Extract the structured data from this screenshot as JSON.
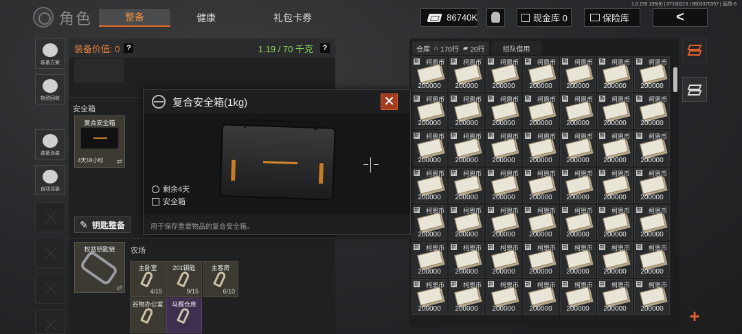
{
  "header": {
    "version": "1.0.159.159(9) | 07160215 | 8603370357 | 品质-6",
    "title": "角色",
    "tabs": [
      {
        "label": "整备",
        "active": true
      },
      {
        "label": "健康",
        "active": false
      },
      {
        "label": "礼包卡券",
        "active": false
      }
    ],
    "balance": "86740K",
    "cash_vault": "现金库 0",
    "insurance_vault": "保险库",
    "back_symbol": "<"
  },
  "sidebar": [
    {
      "label": "装备方案",
      "icon": "gear-loadout-icon"
    },
    {
      "label": "物资回收",
      "icon": "recycle-icon"
    },
    {
      "label": "装备涂装",
      "icon": "paint-icon"
    },
    {
      "label": "自动涂装",
      "icon": "auto-paint-icon"
    }
  ],
  "equipment": {
    "value_label": "装备价值: 0",
    "weight": "1.19 / 70 千克",
    "help": "?",
    "safe_section": "安全箱",
    "safe_item": {
      "name": "复合安全箱",
      "time": "4天18小时"
    },
    "key_button": "钥匙整备",
    "key_item": {
      "name": "权益钥匙链"
    },
    "map_name": "农场",
    "keys": [
      {
        "name": "主卧室",
        "count": "4/15"
      },
      {
        "name": "201钥匙",
        "count": "9/15"
      },
      {
        "name": "主客房",
        "count": "6/10"
      },
      {
        "name": "谷物办公室",
        "count": ""
      },
      {
        "name": "马厩仓库",
        "count": ""
      }
    ]
  },
  "modal": {
    "title": "复合安全箱(1kg)",
    "close": "✕",
    "remaining": "剩余4天",
    "type": "安全箱",
    "description": "用于保存重要物品的复合安全箱。"
  },
  "storage": {
    "tabs": [
      "仓库",
      "170行",
      "20行",
      "组队借用"
    ],
    "item_name": "柯恩币",
    "item_badge": "新",
    "item_amount": "200000",
    "plus": "+"
  }
}
